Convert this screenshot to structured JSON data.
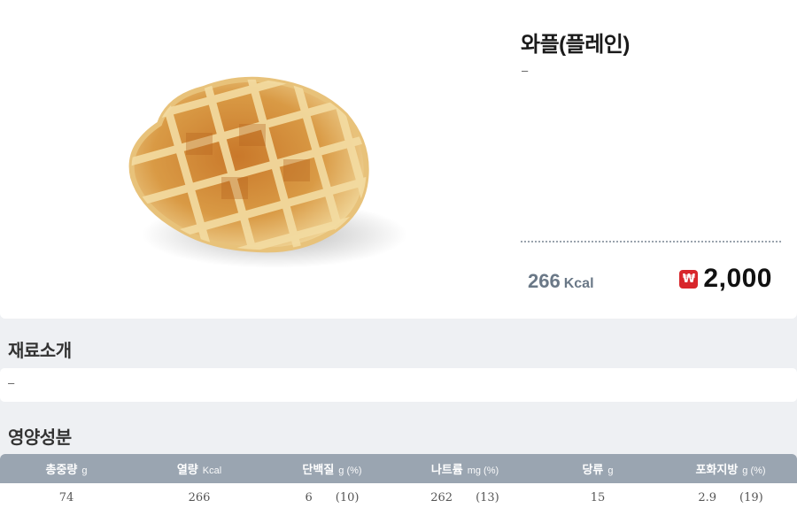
{
  "product": {
    "name": "와플(플레인)",
    "description": "–",
    "calories_value": "266",
    "calories_unit": "Kcal",
    "currency_icon": "won-icon",
    "currency_symbol": "₩",
    "price": "2,000",
    "image_icon": "waffle-icon"
  },
  "ingredients": {
    "title": "재료소개",
    "text": "–"
  },
  "nutrition": {
    "title": "영양성분",
    "columns": [
      {
        "label": "총중량",
        "unit": "g"
      },
      {
        "label": "열량",
        "unit": "Kcal"
      },
      {
        "label": "단백질",
        "unit": "g (%)"
      },
      {
        "label": "나트륨",
        "unit": "mg (%)"
      },
      {
        "label": "당류",
        "unit": "g"
      },
      {
        "label": "포화지방",
        "unit": "g (%)"
      }
    ],
    "values": [
      {
        "value": "74",
        "pct": ""
      },
      {
        "value": "266",
        "pct": ""
      },
      {
        "value": "6",
        "pct": "(10)"
      },
      {
        "value": "262",
        "pct": "(13)"
      },
      {
        "value": "15",
        "pct": ""
      },
      {
        "value": "2.9",
        "pct": "(19)"
      }
    ]
  },
  "colors": {
    "price_badge": "#d8262b",
    "calorie_text": "#6a7887",
    "table_header": "#9aa5b1",
    "page_background": "#eef0f3"
  }
}
